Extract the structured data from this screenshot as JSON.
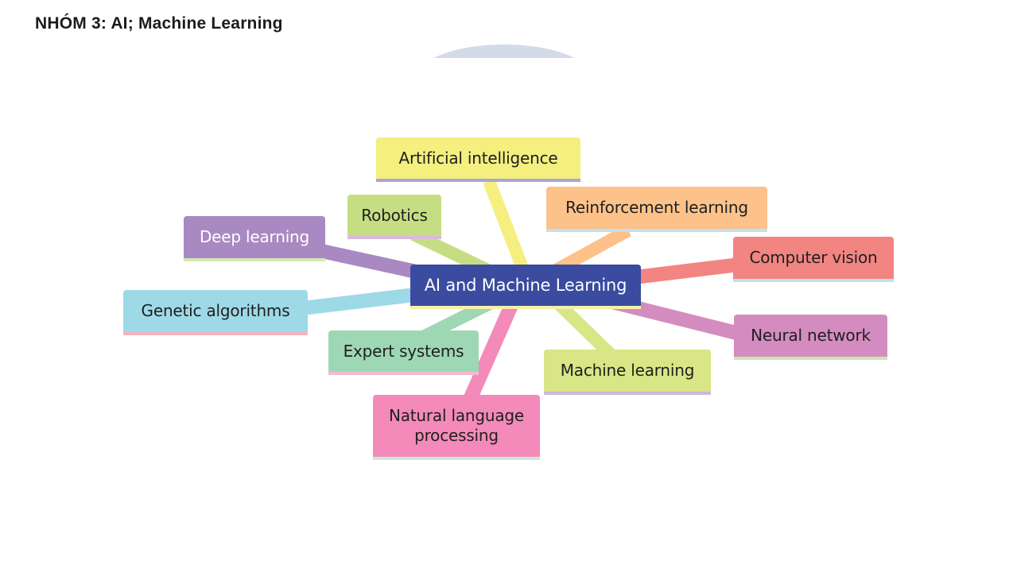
{
  "page": {
    "title": "NHÓM 3: AI; Machine Learning"
  },
  "mindmap": {
    "center": {
      "label": "AI and Machine Learning",
      "color": "#3a4ba0",
      "text_color": "#ffffff",
      "underline": "#f5f0a8"
    },
    "branches": [
      {
        "id": "artificial-intelligence",
        "label": "Artificial intelligence",
        "color": "#f4ef7f",
        "underline": "#aaa5d6",
        "text_color": "#1f1f1f"
      },
      {
        "id": "robotics",
        "label": "Robotics",
        "color": "#c5de84",
        "underline": "#d9b9e0",
        "text_color": "#1f1f1f"
      },
      {
        "id": "reinforcement-learning",
        "label": "Reinforcement learning",
        "color": "#fdc18a",
        "underline": "#c4e0ee",
        "text_color": "#1f1f1f"
      },
      {
        "id": "deep-learning",
        "label": "Deep learning",
        "color": "#a989c2",
        "underline": "#d6e7b4",
        "text_color": "#ffffff"
      },
      {
        "id": "computer-vision",
        "label": "Computer vision",
        "color": "#f28482",
        "underline": "#bfe3ee",
        "text_color": "#1f1f1f"
      },
      {
        "id": "genetic-algorithms",
        "label": "Genetic algorithms",
        "color": "#9ed9e7",
        "underline": "#f5b3c0",
        "text_color": "#1f1f1f"
      },
      {
        "id": "neural-network",
        "label": "Neural network",
        "color": "#d48cc0",
        "underline": "#c8e6b4",
        "text_color": "#1f1f1f"
      },
      {
        "id": "expert-systems",
        "label": "Expert systems",
        "color": "#9ed7b4",
        "underline": "#f6b9d2",
        "text_color": "#1f1f1f"
      },
      {
        "id": "machine-learning",
        "label": "Machine learning",
        "color": "#d8e685",
        "underline": "#cdb7dc",
        "text_color": "#1f1f1f"
      },
      {
        "id": "natural-language-processing",
        "label": "Natural language processing",
        "color": "#f48ab9",
        "underline": "#c8ead8",
        "text_color": "#1f1f1f"
      }
    ]
  }
}
